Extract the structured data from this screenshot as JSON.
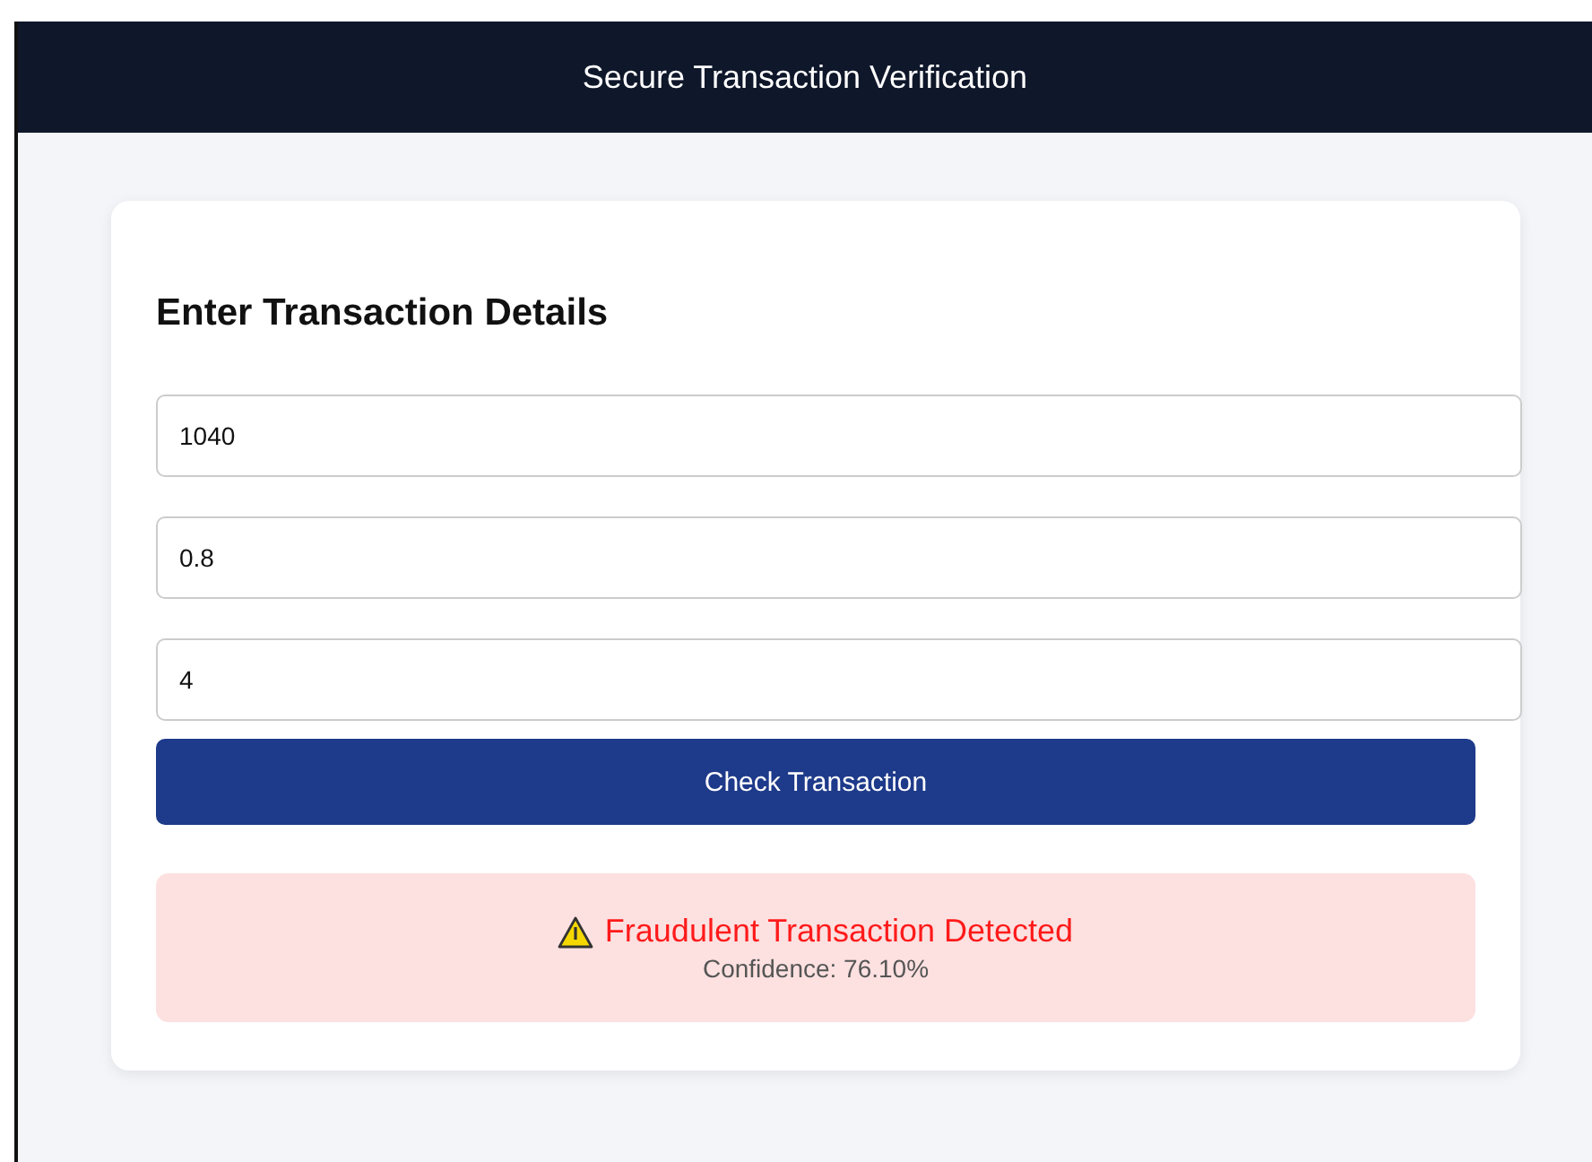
{
  "header": {
    "title": "Secure Transaction Verification"
  },
  "form": {
    "heading": "Enter Transaction Details",
    "fields": [
      {
        "value": "1040"
      },
      {
        "value": "0.8"
      },
      {
        "value": "4"
      }
    ],
    "button": "Check Transaction"
  },
  "result": {
    "kind": "fraud",
    "message": "Fraudulent Transaction Detected",
    "confidence": "Confidence: 76.10%"
  }
}
